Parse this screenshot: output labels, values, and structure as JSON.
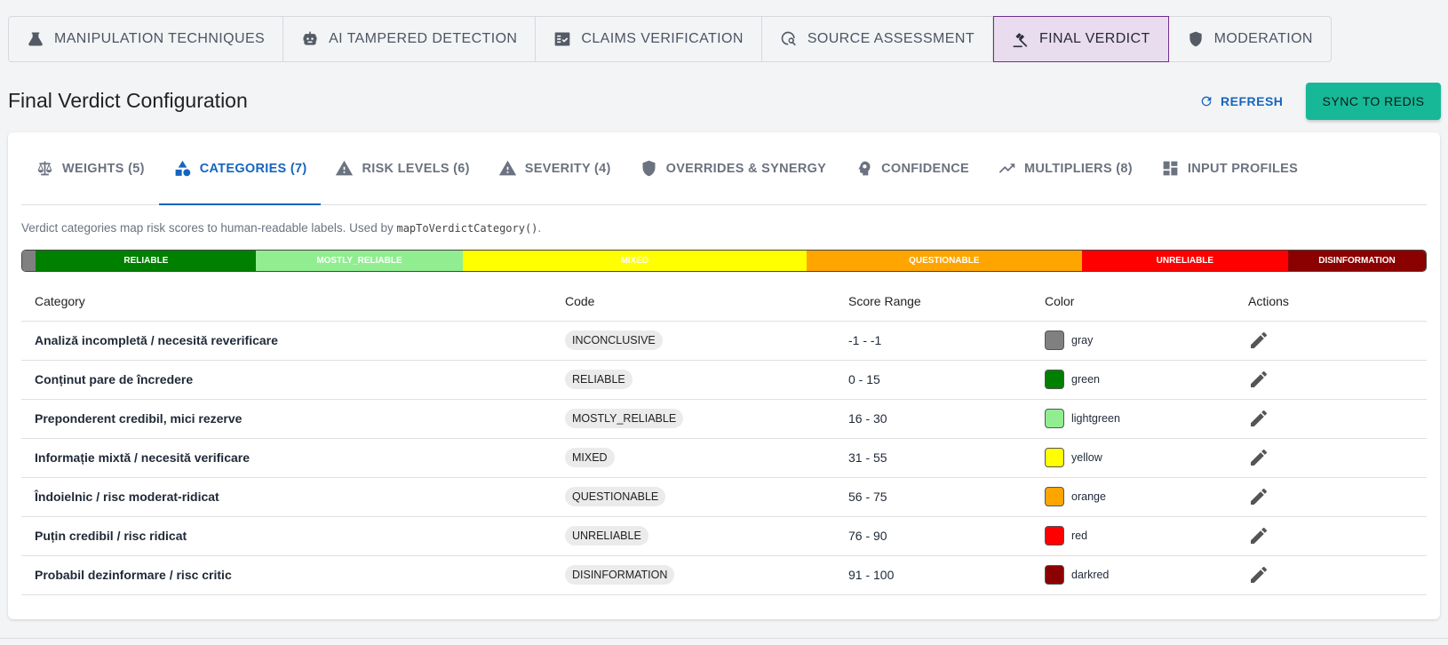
{
  "top_tabs": [
    {
      "label": "MANIPULATION TECHNIQUES",
      "icon": "flask-icon"
    },
    {
      "label": "AI TAMPERED DETECTION",
      "icon": "robot-icon"
    },
    {
      "label": "CLAIMS VERIFICATION",
      "icon": "fact-check-icon"
    },
    {
      "label": "SOURCE ASSESSMENT",
      "icon": "travel-explore-icon"
    },
    {
      "label": "FINAL VERDICT",
      "icon": "gavel-icon",
      "active": true
    },
    {
      "label": "MODERATION",
      "icon": "shield-icon"
    }
  ],
  "header": {
    "title": "Final Verdict Configuration",
    "refresh_label": "REFRESH",
    "sync_label": "SYNC TO REDIS"
  },
  "sub_tabs": [
    {
      "label": "WEIGHTS (5)",
      "icon": "scale-icon"
    },
    {
      "label": "CATEGORIES (7)",
      "icon": "category-icon",
      "active": true
    },
    {
      "label": "RISK LEVELS (6)",
      "icon": "warning-icon"
    },
    {
      "label": "SEVERITY (4)",
      "icon": "warning-icon"
    },
    {
      "label": "OVERRIDES & SYNERGY",
      "icon": "shield-icon"
    },
    {
      "label": "CONFIDENCE",
      "icon": "psychology-icon"
    },
    {
      "label": "MULTIPLIERS (8)",
      "icon": "trending-up-icon"
    },
    {
      "label": "INPUT PROFILES",
      "icon": "dashboard-icon"
    }
  ],
  "description": {
    "text": "Verdict categories map risk scores to human-readable labels. Used by ",
    "code": "mapToVerdictCategory()",
    "suffix": "."
  },
  "category_bar": [
    {
      "label": "",
      "color": "#808080",
      "share": 1
    },
    {
      "label": "RELIABLE",
      "color": "#008000",
      "share": 16,
      "text_color": "#ffffff"
    },
    {
      "label": "MOSTLY_RELIABLE",
      "color": "#90ee90",
      "share": 15,
      "text_color": "#ffffff"
    },
    {
      "label": "MIXED",
      "color": "#ffff00",
      "share": 25,
      "text_color": "#ffffff"
    },
    {
      "label": "QUESTIONABLE",
      "color": "#ffa500",
      "share": 20,
      "text_color": "#ffffff"
    },
    {
      "label": "UNRELIABLE",
      "color": "#ff0000",
      "share": 15,
      "text_color": "#ffffff"
    },
    {
      "label": "DISINFORMATION",
      "color": "#8b0000",
      "share": 10,
      "text_color": "#ffffff"
    }
  ],
  "table": {
    "headers": {
      "category": "Category",
      "code": "Code",
      "score_range": "Score Range",
      "color": "Color",
      "actions": "Actions"
    },
    "rows": [
      {
        "category": "Analiză incompletă / necesită reverificare",
        "code": "INCONCLUSIVE",
        "range": "-1 - -1",
        "color_name": "gray",
        "color_hex": "#808080"
      },
      {
        "category": "Conținut pare de încredere",
        "code": "RELIABLE",
        "range": "0 - 15",
        "color_name": "green",
        "color_hex": "#008000"
      },
      {
        "category": "Preponderent credibil, mici rezerve",
        "code": "MOSTLY_RELIABLE",
        "range": "16 - 30",
        "color_name": "lightgreen",
        "color_hex": "#90ee90"
      },
      {
        "category": "Informație mixtă / necesită verificare",
        "code": "MIXED",
        "range": "31 - 55",
        "color_name": "yellow",
        "color_hex": "#ffff00"
      },
      {
        "category": "Îndoielnic / risc moderat-ridicat",
        "code": "QUESTIONABLE",
        "range": "56 - 75",
        "color_name": "orange",
        "color_hex": "#ffa500"
      },
      {
        "category": "Puțin credibil / risc ridicat",
        "code": "UNRELIABLE",
        "range": "76 - 90",
        "color_name": "red",
        "color_hex": "#ff0000"
      },
      {
        "category": "Probabil dezinformare / risc critic",
        "code": "DISINFORMATION",
        "range": "91 - 100",
        "color_name": "darkred",
        "color_hex": "#8b0000"
      }
    ]
  }
}
